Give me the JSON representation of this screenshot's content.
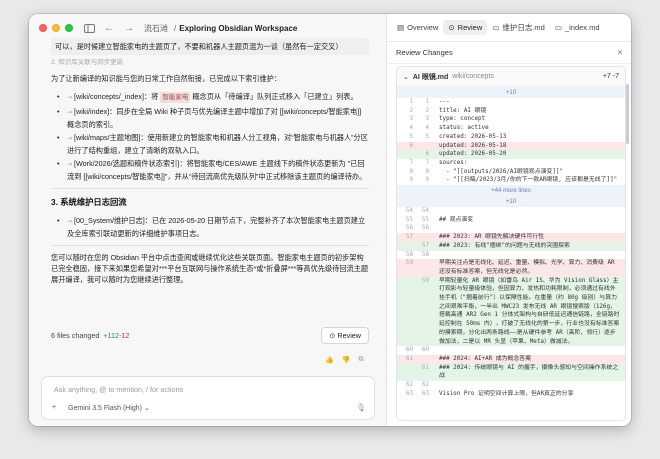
{
  "titlebar": {
    "crumb_parent": "流石滩",
    "crumb_sep": "/",
    "crumb_title": "Exploring Obsidian Workspace"
  },
  "chat": {
    "intro": "可以，是时候建立智能家电的主题页了，不要和机器人主题页混为一谈（虽然有一定交叉）",
    "ghost": "2. 知识库关联与同步更新",
    "para1": "为了让新编译的知识能与您的日常工作自然衔接，已完成以下索引维护：",
    "bullets": [
      {
        "link": "[wiki/concepts/_index]",
        "rest_a": "：将 ",
        "chip": "智能家电",
        "rest_b": " 概念页从「待编译」队列正式移入「已建立」列表。"
      },
      {
        "link": "[wiki/index]",
        "rest_a": "：同步在全局 Wiki 种子页与优先编译主题中增加了对 [[wiki/concepts/智能家电]] 概念页的索引。",
        "chip": "",
        "rest_b": ""
      },
      {
        "link": "[wiki/maps/主题地图]",
        "rest_a": "：使用新建立的智能家电和机器人分工视角，对“智能家电与机器人”分区进行了结构重组，建立了清晰的双轨入口。",
        "chip": "",
        "rest_b": ""
      },
      {
        "link": "[Work/2026/选题和稿件状态索引]",
        "rest_a": "：将智能家电/CES/AWE 主题线下的稿件状态更新为 \"已回流到 [[wiki/concepts/智能家电]]\"，并从“待回流高优先级队列”中正式移除该主题页的编译待办。",
        "chip": "",
        "rest_b": ""
      }
    ],
    "heading3": "3. 系统维护日志回流",
    "bullet3": {
      "link": "[00_System/维护日志]",
      "rest": "：已在 2026-05-20 日期节点下，完整补齐了本次智能家电主题页建立及全库索引联动更新的详细维护事项日志。"
    },
    "para2": "您可以随时在您的 Obsidian 平台中点击查阅或继续优化这些关联页面。智能家电主题页的初步架构已完全稳固，接下来如果您希望对***平台互联网与操作系统生态*或*折叠屏***等高优先级待回流主题展开编译，我可以随时为您继续进行整理。",
    "files_changed": "6 files changed",
    "adds": "+112",
    "dels": "-12",
    "review_label": "Review",
    "input_placeholder": "Ask anything, @ to mention, / for actions",
    "add_symbol": "+",
    "model_name": "Gemini 3.5 Flash (High)",
    "model_chevron": "⌄"
  },
  "right": {
    "tabs": [
      "Overview",
      "Review",
      "维护日志.md",
      "_index.md"
    ],
    "header": "Review Changes",
    "file": {
      "name": "AI 眼镜.md",
      "path": "wiki/concepts",
      "stat": "+7 -7",
      "lines": [
        {
          "a": "1",
          "b": "1",
          "t": "---",
          "k": ""
        },
        {
          "a": "2",
          "b": "2",
          "t": "title: AI 眼镜",
          "k": ""
        },
        {
          "a": "3",
          "b": "3",
          "t": "type: concept",
          "k": ""
        },
        {
          "a": "4",
          "b": "4",
          "t": "status: active",
          "k": ""
        },
        {
          "a": "5",
          "b": "5",
          "t": "created: 2026-05-13",
          "k": ""
        },
        {
          "a": "6",
          "b": "",
          "t": "updated: 2026-05-18",
          "k": "del"
        },
        {
          "a": "",
          "b": "6",
          "t": "updated: 2026-05-20",
          "k": "add"
        },
        {
          "a": "7",
          "b": "7",
          "t": "sources:",
          "k": ""
        },
        {
          "a": "8",
          "b": "8",
          "t": "  - \"[[outputs/2026/AI眼镜观点演变]]\"",
          "k": ""
        },
        {
          "a": "9",
          "b": "9",
          "t": "  - \"[[扫稿/2023/3月/你的下一款AR眼镜, 应该都是无线了]]\"",
          "k": ""
        }
      ],
      "expand1": "+10",
      "expand2": "+44 more lines",
      "expand3": "+10",
      "lines2": [
        {
          "a": "54",
          "b": "54",
          "t": "",
          "k": ""
        },
        {
          "a": "55",
          "b": "55",
          "t": "## 观点演变",
          "k": ""
        },
        {
          "a": "56",
          "b": "56",
          "t": "",
          "k": ""
        },
        {
          "a": "57",
          "b": "",
          "t": "### 2023: AR 眼镜先解决硬件可行性",
          "k": "del"
        },
        {
          "a": "",
          "b": "57",
          "t": "### 2023: 有线\"捆绑\"的问题与无线的突围探索",
          "k": "add"
        },
        {
          "a": "58",
          "b": "58",
          "t": "",
          "k": ""
        },
        {
          "a": "59",
          "b": "",
          "t": "早期关注点是无线化、延迟、重量、模拟、光学、算力、消费级 AR 还没有标准答案，但无线化是必然。",
          "k": "del"
        },
        {
          "a": "",
          "b": "59",
          "t": "早期轻量化 AR 眼镜（如雷鸟 Air 1S、华为 Vision Glass）主打观影与轻量级体验，但因算力、发热和功耗限制，必须通过有线外挂手机（\"捆着前行\"）以保障性能。在重量（约 80g 级别）与算力之间艰难平衡，一半出 MWC23 发布无线 AR 眼镜搜索版（126g，搭载高通 AR2 Gen 1 分体式架构与自研低延迟通信链路，全链路时延控制在 50ms 内），打破了无线化的第一步，行业也没有标准答案的摸索期，分化出两条路线——是从硬件参考 AR（高阶、领行）逐步做加法，二是以 MR 头显（苹果、Meta）做减法。",
          "k": "add"
        },
        {
          "a": "60",
          "b": "60",
          "t": "",
          "k": ""
        },
        {
          "a": "61",
          "b": "",
          "t": "### 2024: AI+AR 成为概念答案",
          "k": "del"
        },
        {
          "a": "",
          "b": "61",
          "t": "### 2024: 传统眼镜与 AI 的握手，摄像头感知与空间操作系统之战",
          "k": "add"
        },
        {
          "a": "62",
          "b": "62",
          "t": "",
          "k": ""
        },
        {
          "a": "63",
          "b": "63",
          "t": "Vision Pro 证明空间计算上限，但AR真正的分享",
          "k": ""
        }
      ]
    }
  },
  "colors": {
    "red_light": "#ff5f57",
    "yellow_light": "#febc2e",
    "green_light": "#28c840"
  }
}
